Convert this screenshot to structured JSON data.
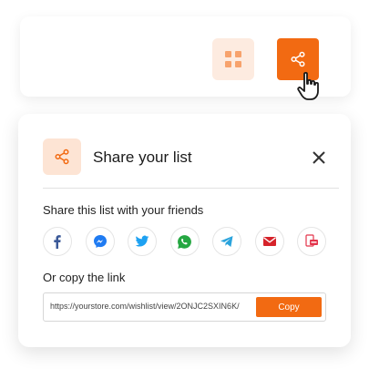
{
  "toolbar": {
    "grid_icon": "grid-icon",
    "share_icon": "share-icon",
    "cursor_icon": "hand-pointer-icon"
  },
  "share_modal": {
    "title": "Share your list",
    "subtitle": "Share this list with your friends",
    "copy_label": "Or copy the link",
    "link_value": "https://yourstore.com/wishlist/view/2ONJC2SXIN6K/",
    "copy_button": "Copy",
    "socials": [
      "facebook-icon",
      "messenger-icon",
      "twitter-icon",
      "whatsapp-icon",
      "telegram-icon",
      "email-icon",
      "sms-icon"
    ]
  },
  "colors": {
    "accent": "#f26a12",
    "accent_light": "#fde4d4",
    "facebook": "#3b5998",
    "messenger": "#1f7bf2",
    "twitter": "#1da1f2",
    "whatsapp": "#25a742",
    "telegram": "#2aa3dc",
    "email": "#d6232a",
    "sms": "#e3344b"
  }
}
